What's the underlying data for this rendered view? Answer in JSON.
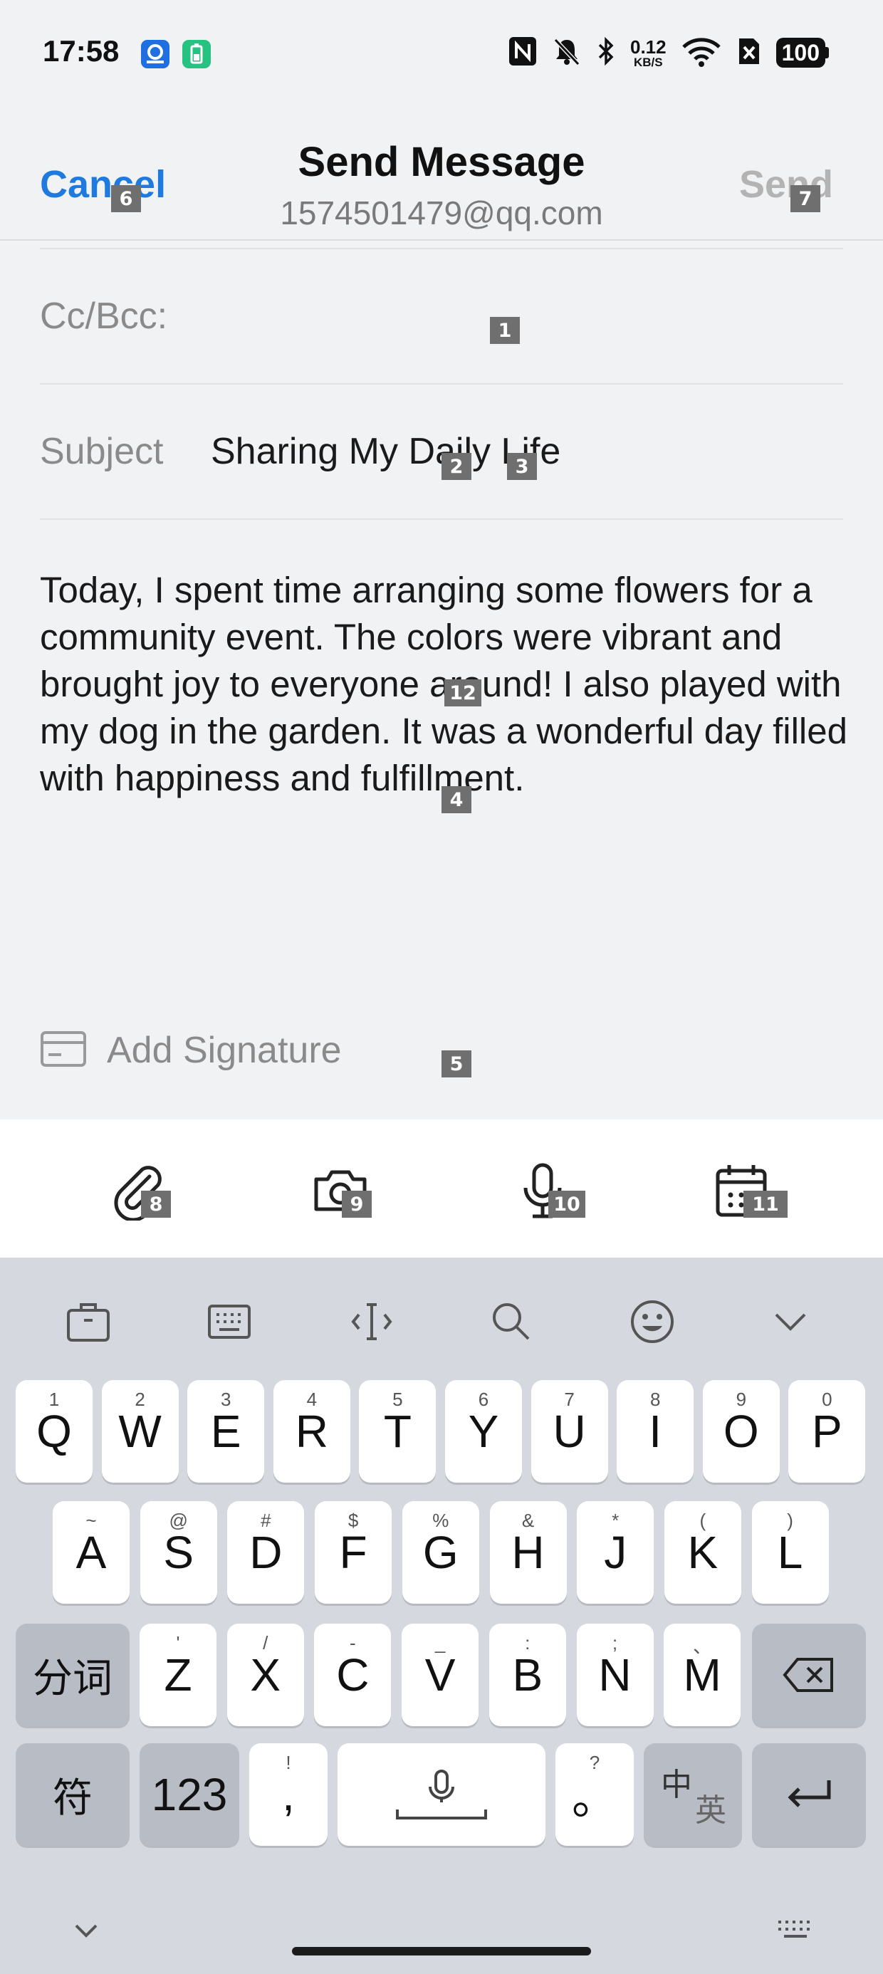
{
  "status_bar": {
    "time": "17:58",
    "net_speed_value": "0.12",
    "net_speed_unit": "KB/S",
    "battery": "100",
    "icons": [
      "nfc-icon",
      "mute-icon",
      "bluetooth-icon",
      "wifi-icon",
      "sim-off-icon"
    ]
  },
  "header": {
    "cancel_label": "Cancel",
    "title": "Send Message",
    "subtitle": "1574501479@qq.com",
    "send_label": "Send"
  },
  "compose": {
    "cc_label": "Cc/Bcc:",
    "subject_label": "Subject",
    "subject_value": "Sharing My Daily Life",
    "body": "Today, I spent time arranging some flowers for a community event. The colors were vibrant and brought joy to everyone around! I also played with my dog in the garden. It was a wonderful day filled with happiness and fulfillment.",
    "signature_label": "Add Signature"
  },
  "attach_bar": {
    "items": [
      "paperclip-icon",
      "camera-icon",
      "microphone-icon",
      "calendar-icon"
    ]
  },
  "keyboard": {
    "row1": [
      {
        "key": "Q",
        "hint": "1"
      },
      {
        "key": "W",
        "hint": "2"
      },
      {
        "key": "E",
        "hint": "3"
      },
      {
        "key": "R",
        "hint": "4"
      },
      {
        "key": "T",
        "hint": "5"
      },
      {
        "key": "Y",
        "hint": "6"
      },
      {
        "key": "U",
        "hint": "7"
      },
      {
        "key": "I",
        "hint": "8"
      },
      {
        "key": "O",
        "hint": "9"
      },
      {
        "key": "P",
        "hint": "0"
      }
    ],
    "row2": [
      {
        "key": "A",
        "hint": "~"
      },
      {
        "key": "S",
        "hint": "@"
      },
      {
        "key": "D",
        "hint": "#"
      },
      {
        "key": "F",
        "hint": "$"
      },
      {
        "key": "G",
        "hint": "%"
      },
      {
        "key": "H",
        "hint": "&"
      },
      {
        "key": "J",
        "hint": "*"
      },
      {
        "key": "K",
        "hint": "("
      },
      {
        "key": "L",
        "hint": ")"
      }
    ],
    "row3": [
      {
        "key": "Z",
        "hint": "'"
      },
      {
        "key": "X",
        "hint": "/"
      },
      {
        "key": "C",
        "hint": "-"
      },
      {
        "key": "V",
        "hint": "_"
      },
      {
        "key": "B",
        "hint": ":"
      },
      {
        "key": "N",
        "hint": ";"
      },
      {
        "key": "M",
        "hint": "、"
      }
    ],
    "segment_label": "分词",
    "symbol_label": "符",
    "numbers_label": "123",
    "comma_key": ",",
    "comma_hint": "!",
    "period_key": "。",
    "period_hint": "?",
    "lang_top": "中",
    "lang_bottom": "英"
  },
  "markers": [
    "1",
    "2",
    "3",
    "4",
    "5",
    "6",
    "7",
    "8",
    "9",
    "10",
    "11",
    "12"
  ],
  "colors": {
    "accent": "#1f7ae0",
    "background": "#f1f2f4",
    "keyboard_bg": "#d5d8df"
  }
}
